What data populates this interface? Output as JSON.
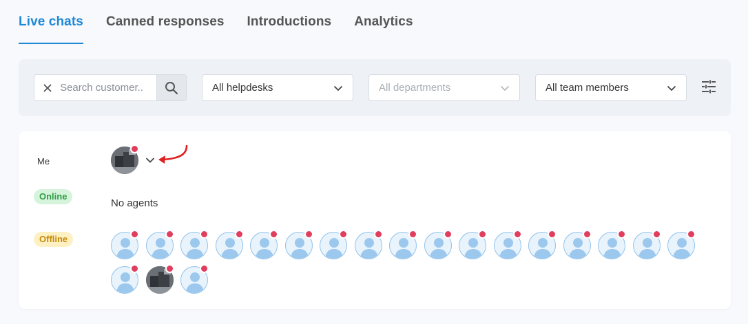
{
  "tabs": [
    {
      "label": "Live chats",
      "active": true
    },
    {
      "label": "Canned responses"
    },
    {
      "label": "Introductions"
    },
    {
      "label": "Analytics"
    }
  ],
  "filters": {
    "search_placeholder": "Search customer..",
    "helpdesks": "All helpdesks",
    "departments": "All departments",
    "team_members": "All team members"
  },
  "agents": {
    "me_label": "Me",
    "online_label": "Online",
    "offline_label": "Offline",
    "no_agents_text": "No agents",
    "offline_count": 20
  },
  "colors": {
    "accent": "#1e88d6",
    "status_dot": "#e03e5c",
    "arrow": "#e02020"
  }
}
